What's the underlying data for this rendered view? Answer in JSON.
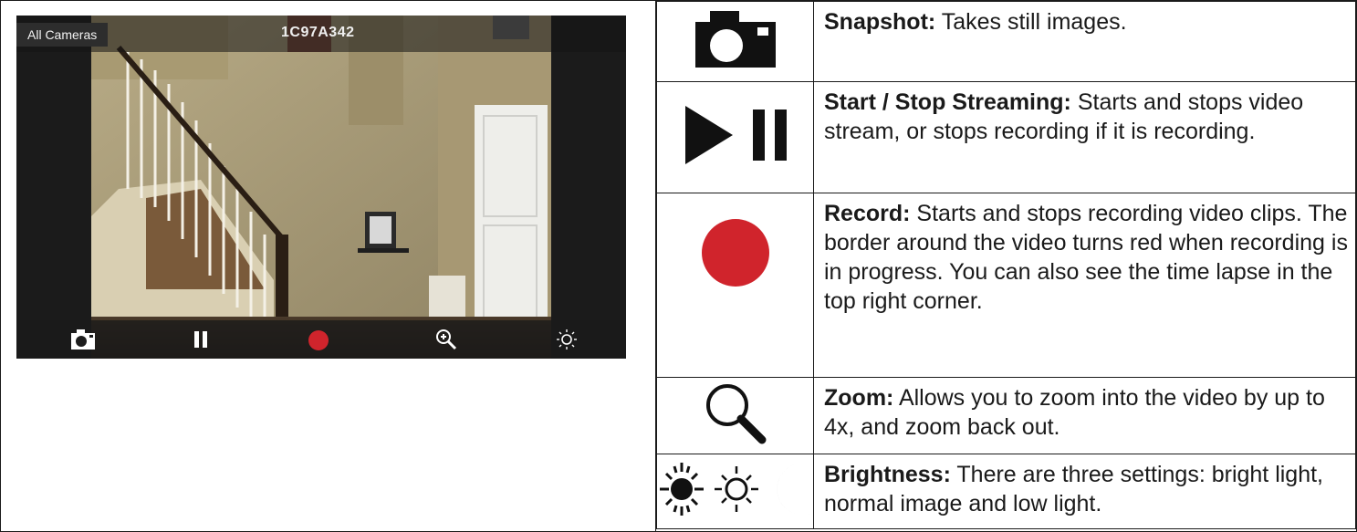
{
  "camera": {
    "all_cameras_label": "All Cameras",
    "camera_id": "1C97A342",
    "toolbar": {
      "snapshot_icon": "camera-icon",
      "pause_icon": "pause-icon",
      "record_icon": "record-dot-icon",
      "zoom_icon": "zoom-in-icon",
      "brightness_icon": "brightness-icon"
    }
  },
  "legend": {
    "rows": [
      {
        "icon": "camera-icon",
        "title": "Snapshot:",
        "desc": " Takes still images."
      },
      {
        "icon": "play-pause-icon",
        "title": "Start / Stop  Streaming:",
        "desc": " Starts and stops video stream, or stops recording if it is recording."
      },
      {
        "icon": "record-icon",
        "title": "Record:",
        "desc": " Starts and stops recording video clips. The border around the video turns red when recording is in progress. You can also see the time lapse in the top right corner."
      },
      {
        "icon": "magnifier-icon",
        "title": "Zoom:",
        "desc": " Allows you to zoom into the video by up to 4x, and zoom back out."
      },
      {
        "icon": "brightness-modes-icon",
        "title": "Brightness:",
        "desc": " There are three settings: bright light, normal image and low light."
      }
    ]
  },
  "colors": {
    "record_red": "#d0242c",
    "icon_black": "#111111"
  }
}
